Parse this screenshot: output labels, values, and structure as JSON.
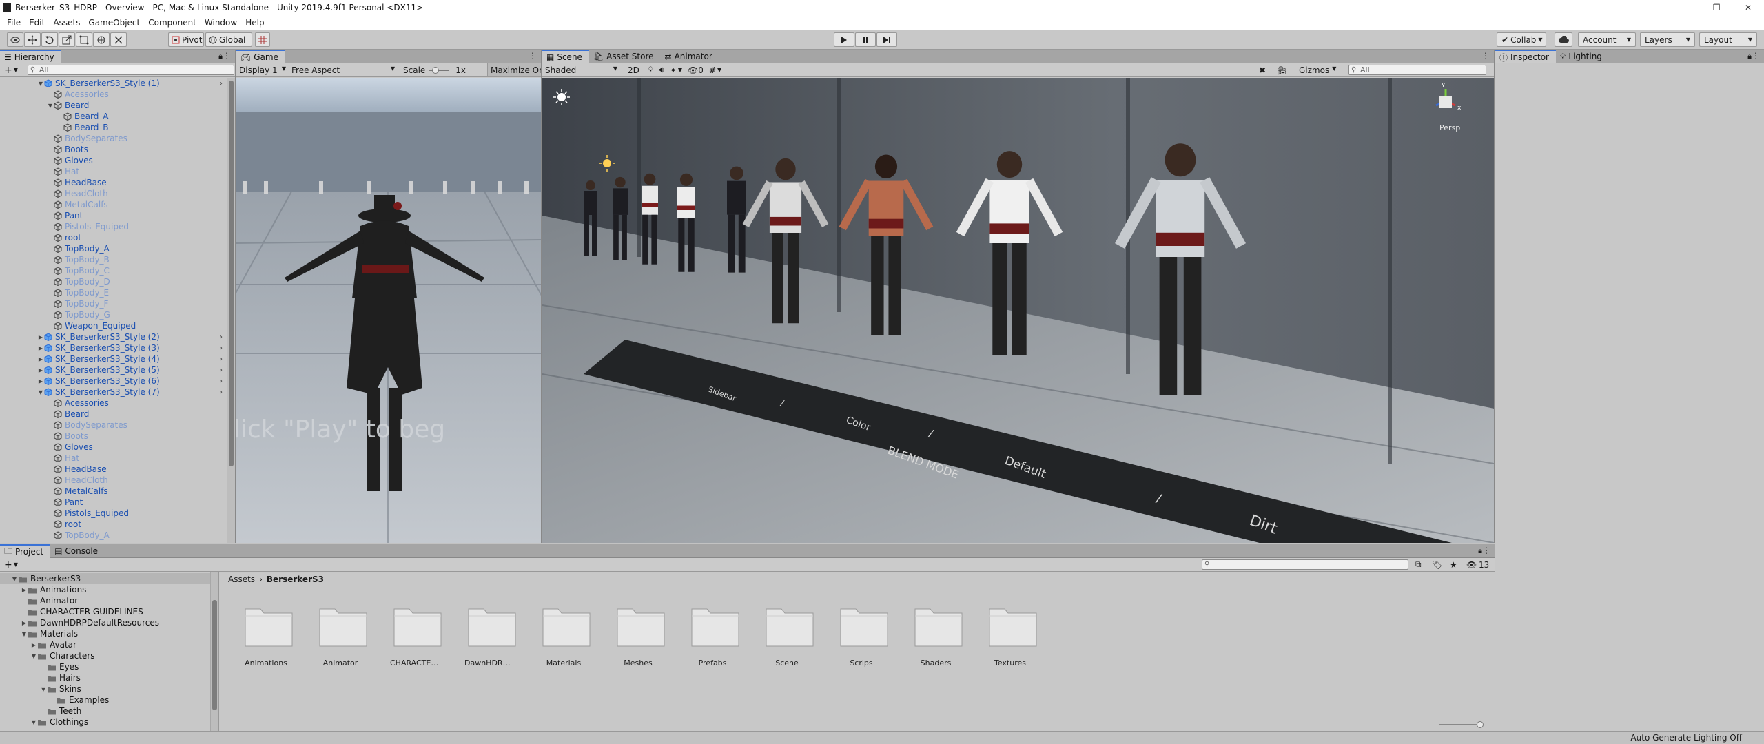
{
  "window": {
    "title": "Berserker_S3_HDRP - Overview - PC, Mac & Linux Standalone - Unity 2019.4.9f1 Personal <DX11>",
    "min": "–",
    "max": "❐",
    "close": "✕"
  },
  "menu": [
    "File",
    "Edit",
    "Assets",
    "GameObject",
    "Component",
    "Window",
    "Help"
  ],
  "toolbar": {
    "pivot": "Pivot",
    "global": "Global",
    "collab": "Collab",
    "account": "Account",
    "layers": "Layers",
    "layout": "Layout"
  },
  "hierarchy": {
    "tab": "Hierarchy",
    "search_placeholder": "All",
    "rows": [
      {
        "t": "SK_BerserkerS3_Style (1)",
        "d": 1,
        "a": "▼",
        "k": "prefab"
      },
      {
        "t": "Acessories",
        "d": 2,
        "a": "",
        "k": "faded"
      },
      {
        "t": "Beard",
        "d": 2,
        "a": "▼",
        "k": "prefab"
      },
      {
        "t": "Beard_A",
        "d": 3,
        "a": "",
        "k": "prefab"
      },
      {
        "t": "Beard_B",
        "d": 3,
        "a": "",
        "k": "prefab"
      },
      {
        "t": "BodySeparates",
        "d": 2,
        "a": "",
        "k": "faded"
      },
      {
        "t": "Boots",
        "d": 2,
        "a": "",
        "k": "prefab"
      },
      {
        "t": "Gloves",
        "d": 2,
        "a": "",
        "k": "prefab"
      },
      {
        "t": "Hat",
        "d": 2,
        "a": "",
        "k": "faded"
      },
      {
        "t": "HeadBase",
        "d": 2,
        "a": "",
        "k": "prefab"
      },
      {
        "t": "HeadCloth",
        "d": 2,
        "a": "",
        "k": "faded"
      },
      {
        "t": "MetalCalfs",
        "d": 2,
        "a": "",
        "k": "faded"
      },
      {
        "t": "Pant",
        "d": 2,
        "a": "",
        "k": "prefab"
      },
      {
        "t": "Pistols_Equiped",
        "d": 2,
        "a": "",
        "k": "faded"
      },
      {
        "t": "root",
        "d": 2,
        "a": "",
        "k": "prefab"
      },
      {
        "t": "TopBody_A",
        "d": 2,
        "a": "",
        "k": "prefab"
      },
      {
        "t": "TopBody_B",
        "d": 2,
        "a": "",
        "k": "faded"
      },
      {
        "t": "TopBody_C",
        "d": 2,
        "a": "",
        "k": "faded"
      },
      {
        "t": "TopBody_D",
        "d": 2,
        "a": "",
        "k": "faded"
      },
      {
        "t": "TopBody_E",
        "d": 2,
        "a": "",
        "k": "faded"
      },
      {
        "t": "TopBody_F",
        "d": 2,
        "a": "",
        "k": "faded"
      },
      {
        "t": "TopBody_G",
        "d": 2,
        "a": "",
        "k": "faded"
      },
      {
        "t": "Weapon_Equiped",
        "d": 2,
        "a": "",
        "k": "prefab"
      },
      {
        "t": "SK_BerserkerS3_Style (2)",
        "d": 1,
        "a": "▶",
        "k": "prefab"
      },
      {
        "t": "SK_BerserkerS3_Style (3)",
        "d": 1,
        "a": "▶",
        "k": "prefab"
      },
      {
        "t": "SK_BerserkerS3_Style (4)",
        "d": 1,
        "a": "▶",
        "k": "prefab"
      },
      {
        "t": "SK_BerserkerS3_Style (5)",
        "d": 1,
        "a": "▶",
        "k": "prefab"
      },
      {
        "t": "SK_BerserkerS3_Style (6)",
        "d": 1,
        "a": "▶",
        "k": "prefab"
      },
      {
        "t": "SK_BerserkerS3_Style (7)",
        "d": 1,
        "a": "▼",
        "k": "prefab"
      },
      {
        "t": "Acessories",
        "d": 2,
        "a": "",
        "k": "prefab"
      },
      {
        "t": "Beard",
        "d": 2,
        "a": "",
        "k": "prefab"
      },
      {
        "t": "BodySeparates",
        "d": 2,
        "a": "",
        "k": "faded"
      },
      {
        "t": "Boots",
        "d": 2,
        "a": "",
        "k": "faded"
      },
      {
        "t": "Gloves",
        "d": 2,
        "a": "",
        "k": "prefab"
      },
      {
        "t": "Hat",
        "d": 2,
        "a": "",
        "k": "faded"
      },
      {
        "t": "HeadBase",
        "d": 2,
        "a": "",
        "k": "prefab"
      },
      {
        "t": "HeadCloth",
        "d": 2,
        "a": "",
        "k": "faded"
      },
      {
        "t": "MetalCalfs",
        "d": 2,
        "a": "",
        "k": "prefab"
      },
      {
        "t": "Pant",
        "d": 2,
        "a": "",
        "k": "prefab"
      },
      {
        "t": "Pistols_Equiped",
        "d": 2,
        "a": "",
        "k": "prefab"
      },
      {
        "t": "root",
        "d": 2,
        "a": "",
        "k": "prefab"
      },
      {
        "t": "TopBody_A",
        "d": 2,
        "a": "",
        "k": "faded"
      }
    ]
  },
  "game": {
    "tab": "Game",
    "display": "Display 1",
    "aspect": "Free Aspect",
    "scale_label": "Scale",
    "scale_value": "1x",
    "maximize": "Maximize On",
    "overlay_text": "lick \"Play\" to beg"
  },
  "scene": {
    "tabs": [
      "Scene",
      "Asset Store",
      "Animator"
    ],
    "shading": "Shaded",
    "mode_2d": "2D",
    "hidden_count": "0",
    "gizmos": "Gizmos",
    "search_placeholder": "All",
    "persp": "Persp",
    "axis_y": "y",
    "axis_x": "x",
    "floor_labels": [
      "Sidebar",
      "/",
      "Color",
      "/",
      "BLEND MODE",
      "Default",
      "/",
      "Dirt"
    ]
  },
  "inspector": {
    "tabs": [
      "Inspector",
      "Lighting"
    ]
  },
  "project": {
    "tabs": [
      "Project",
      "Console"
    ],
    "breadcrumb": [
      "Assets",
      "BerserkerS3"
    ],
    "hidden_count": "13",
    "tree": [
      {
        "t": "BerserkerS3",
        "d": 0,
        "a": "▼"
      },
      {
        "t": "Animations",
        "d": 1,
        "a": "▶"
      },
      {
        "t": "Animator",
        "d": 1,
        "a": ""
      },
      {
        "t": "CHARACTER GUIDELINES",
        "d": 1,
        "a": ""
      },
      {
        "t": "DawnHDRPDefaultResources",
        "d": 1,
        "a": "▶"
      },
      {
        "t": "Materials",
        "d": 1,
        "a": "▼"
      },
      {
        "t": "Avatar",
        "d": 2,
        "a": "▶"
      },
      {
        "t": "Characters",
        "d": 2,
        "a": "▼"
      },
      {
        "t": "Eyes",
        "d": 3,
        "a": ""
      },
      {
        "t": "Hairs",
        "d": 3,
        "a": ""
      },
      {
        "t": "Skins",
        "d": 3,
        "a": "▼"
      },
      {
        "t": "Examples",
        "d": 4,
        "a": ""
      },
      {
        "t": "Teeth",
        "d": 3,
        "a": ""
      },
      {
        "t": "Clothings",
        "d": 2,
        "a": "▼"
      }
    ],
    "folders": [
      "Animations",
      "Animator",
      "CHARACTER GUI...",
      "DawnHDRPDefaul...",
      "Materials",
      "Meshes",
      "Prefabs",
      "Scene",
      "Scrips",
      "Shaders",
      "Textures"
    ]
  },
  "status": {
    "text": "Auto Generate Lighting Off"
  },
  "colors": {
    "accent": "#3a72d6",
    "prefab": "#1b4fb0",
    "faded": "#7f9acd"
  }
}
